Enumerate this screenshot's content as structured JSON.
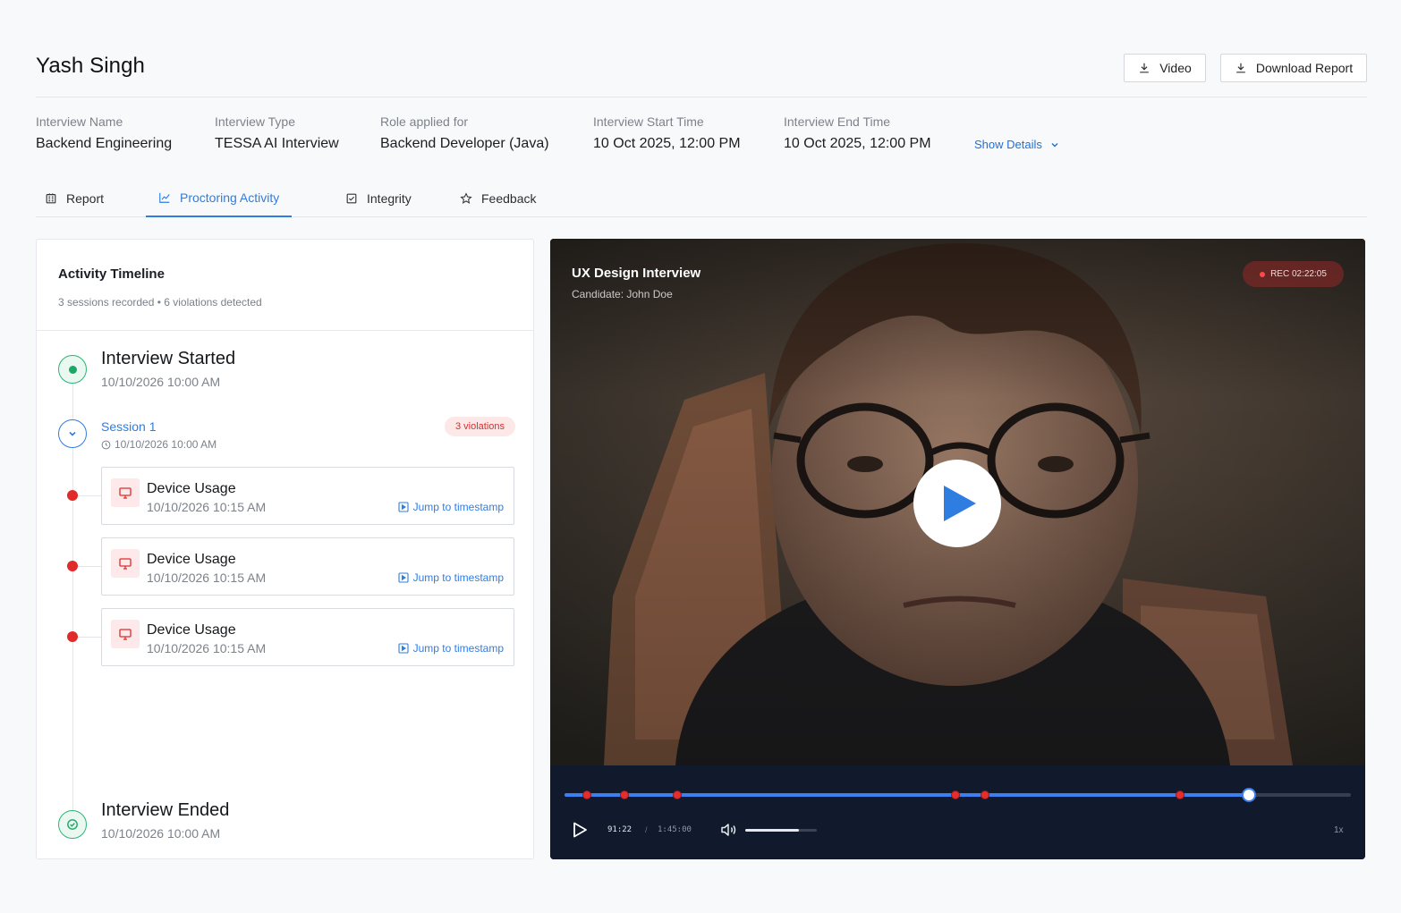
{
  "candidate_name": "Yash Singh",
  "header_buttons": {
    "video": "Video",
    "download_report": "Download Report"
  },
  "meta": [
    {
      "label": "Interview Name",
      "value": "Backend Engineering"
    },
    {
      "label": "Interview Type",
      "value": "TESSA AI Interview"
    },
    {
      "label": "Role applied for",
      "value": "Backend Developer (Java)"
    },
    {
      "label": "Interview Start Time",
      "value": "10 Oct 2025, 12:00 PM"
    },
    {
      "label": "Interview End Time",
      "value": "10 Oct 2025, 12:00 PM"
    }
  ],
  "show_details": "Show Details",
  "tabs": [
    {
      "label": "Report",
      "icon": "report-icon"
    },
    {
      "label": "Proctoring Activity",
      "icon": "chart-line-icon",
      "active": true
    },
    {
      "label": "Integrity",
      "icon": "checkbox-icon"
    },
    {
      "label": "Feedback",
      "icon": "star-icon"
    }
  ],
  "timeline": {
    "title": "Activity Timeline",
    "subtitle": "3 sessions recorded • 6 violations detected",
    "started": {
      "title": "Interview Started",
      "time": "10/10/2026 10:00 AM"
    },
    "session": {
      "name": "Session 1",
      "time": "10/10/2026 10:00 AM",
      "badge": "3 violations"
    },
    "violations": [
      {
        "title": "Device Usage",
        "time": "10/10/2026 10:15 AM",
        "action": "Jump to timestamp"
      },
      {
        "title": "Device Usage",
        "time": "10/10/2026 10:15 AM",
        "action": "Jump to timestamp"
      },
      {
        "title": "Device Usage",
        "time": "10/10/2026 10:15 AM",
        "action": "Jump to timestamp"
      }
    ],
    "ended": {
      "title": "Interview Ended",
      "time": "10/10/2026 10:00 AM"
    }
  },
  "video": {
    "title": "UX Design Interview",
    "candidate": "Candidate: John Doe",
    "rec": "REC 02:22:05",
    "current_time": "91:22",
    "separator": "/",
    "total_time": "1:45:00",
    "speed": "1x",
    "progress_fraction": 0.87,
    "volume_fraction": 0.75,
    "violation_marker_fractions": [
      0.028,
      0.076,
      0.143,
      0.497,
      0.535,
      0.783
    ],
    "colors": {
      "progress": "#3b7ff0",
      "marker": "#e62d2d",
      "controls_bg": "#101a2c"
    }
  },
  "colors": {
    "accent": "#2f7de1",
    "success": "#1aa864",
    "danger": "#e02b2b"
  }
}
